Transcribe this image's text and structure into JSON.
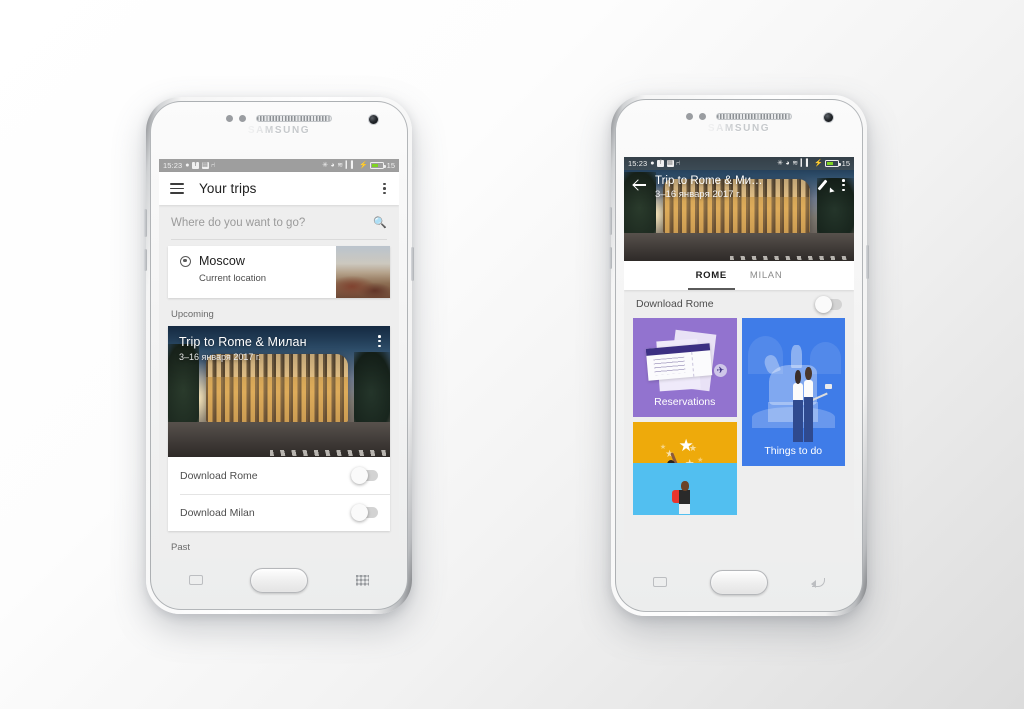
{
  "scene": {
    "description": "Two Samsung Galaxy phones showing Google Trips app screens",
    "background_color": "#f4f4f4"
  },
  "device": {
    "brand": "SAMSUNG"
  },
  "status_bar": {
    "time": "15:23",
    "left_icons": [
      "message-icon",
      "facebook-icon",
      "photos-icon",
      "usb-icon"
    ],
    "right_icons": [
      "bluetooth-icon",
      "alarm-icon",
      "wifi-icon",
      "signal-icon",
      "charging-icon"
    ],
    "battery_percent": "15"
  },
  "left_phone": {
    "app_bar": {
      "menu_icon": "hamburger-icon",
      "title": "Your trips",
      "overflow_icon": "kebab-menu-icon"
    },
    "search": {
      "placeholder": "Where do you want to go?",
      "icon": "search-icon"
    },
    "current_location_card": {
      "icon": "gps-target-icon",
      "name": "Moscow",
      "subtitle": "Current location",
      "thumbnail": "moscow-skyline-thumbnail"
    },
    "sections": {
      "upcoming_label": "Upcoming",
      "past_label": "Past"
    },
    "trip_card": {
      "title": "Trip to Rome & Милан",
      "dates": "3–16 января 2017 г.",
      "hero_image": "colosseum-photo",
      "overflow_icon": "kebab-menu-icon",
      "download_rows": [
        {
          "label": "Download Rome",
          "toggle_on": false
        },
        {
          "label": "Download Milan",
          "toggle_on": false
        }
      ]
    },
    "nav_bar": {
      "recents_icon": "recents-icon",
      "home_icon": "home-button",
      "menu_icon": "menu-grid-icon"
    }
  },
  "right_phone": {
    "app_bar": {
      "back_icon": "back-arrow-icon",
      "title": "Trip to Rome & Ми…",
      "dates": "3–16 января 2017 г.",
      "edit_icon": "pencil-edit-icon",
      "overflow_icon": "kebab-menu-icon",
      "hero_image": "colosseum-photo"
    },
    "tabs": [
      {
        "label": "ROME",
        "active": true
      },
      {
        "label": "MILAN",
        "active": false
      }
    ],
    "download_row": {
      "label": "Download Rome",
      "toggle_on": false
    },
    "tiles": [
      {
        "label": "Reservations",
        "color": "#9273cf",
        "illustration": "boarding-pass-illustration"
      },
      {
        "label": "Things to do",
        "color": "#3f7ce8",
        "illustration": "equestrian-statue-selfie-illustration"
      },
      {
        "label": "",
        "color": "#eeaa0b",
        "illustration": "girl-reaching-stars-illustration"
      },
      {
        "label": "",
        "color": "#52bff0",
        "illustration": "backpacker-walking-illustration"
      }
    ],
    "nav_bar": {
      "recents_icon": "recents-icon",
      "home_icon": "home-button",
      "back_icon": "back-nav-icon"
    }
  }
}
